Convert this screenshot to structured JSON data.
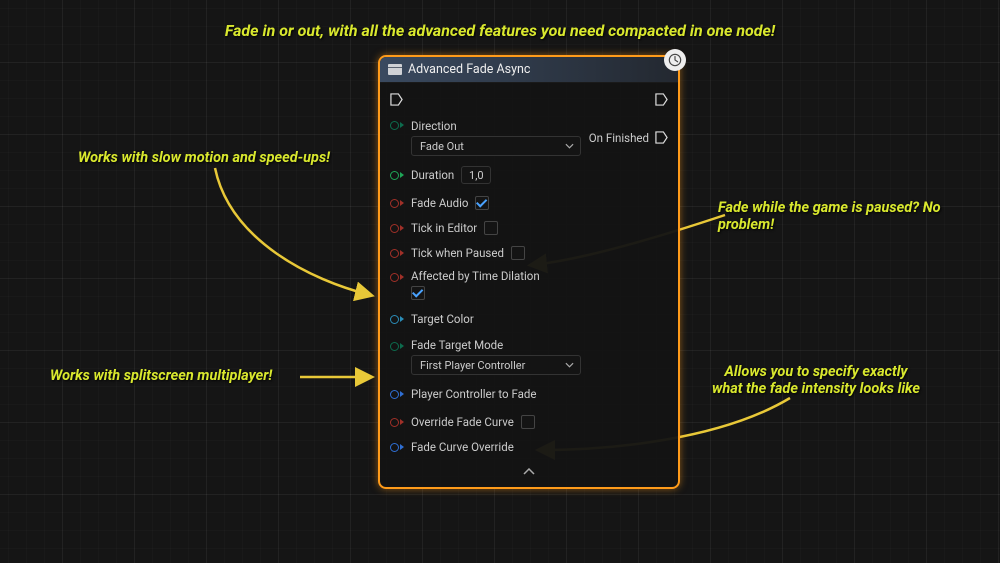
{
  "annotations": {
    "main": "Fade in or out, with all the advanced features you need compacted in one node!",
    "slowmo": "Works with slow motion and speed-ups!",
    "paused": "Fade while the game is paused? No problem!",
    "splitscreen": "Works with splitscreen multiplayer!",
    "intensity_line1": "Allows you to specify exactly",
    "intensity_line2": "what the fade intensity looks like"
  },
  "node": {
    "title": "Advanced Fade Async",
    "outputs": {
      "on_finished": "On Finished"
    },
    "inputs": {
      "direction_label": "Direction",
      "direction_value": "Fade Out",
      "duration_label": "Duration",
      "duration_value": "1,0",
      "fade_audio_label": "Fade Audio",
      "fade_audio_checked": true,
      "tick_editor_label": "Tick in Editor",
      "tick_editor_checked": false,
      "tick_paused_label": "Tick when Paused",
      "tick_paused_checked": false,
      "time_dilation_label": "Affected by Time Dilation",
      "time_dilation_checked": true,
      "target_color_label": "Target Color",
      "fade_target_mode_label": "Fade Target Mode",
      "fade_target_mode_value": "First Player Controller",
      "player_controller_label": "Player Controller to Fade",
      "override_curve_label": "Override Fade Curve",
      "override_curve_checked": false,
      "curve_override_label": "Fade Curve Override"
    }
  }
}
